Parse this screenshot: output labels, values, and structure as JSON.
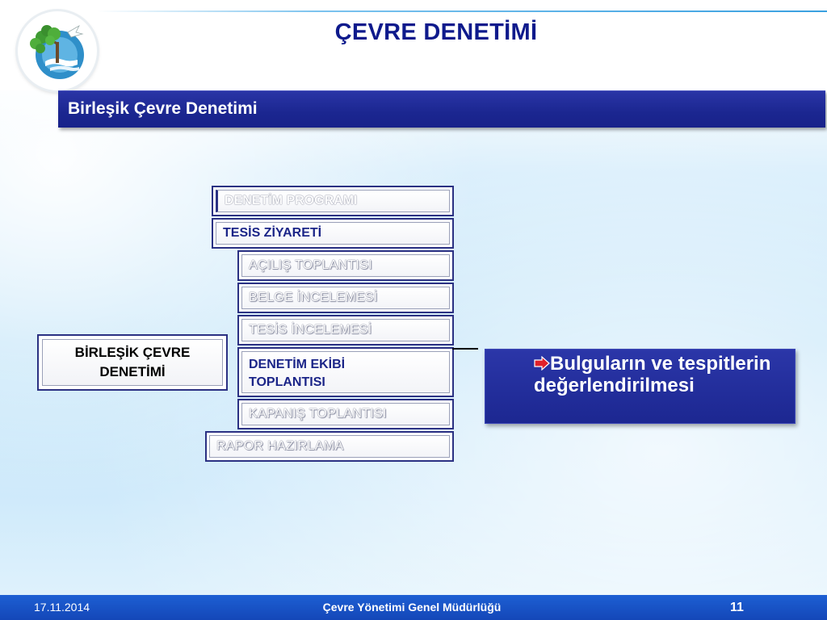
{
  "header": {
    "title": "ÇEVRE DENETİMİ",
    "logo": "ministry-tree-logo"
  },
  "section": {
    "title": "Birleşik Çevre Denetimi"
  },
  "birlesik_box": {
    "label": "BİRLEŞİK ÇEVRE\nDENETİMİ"
  },
  "steps": [
    {
      "label": "DENETİM PROGRAMI"
    },
    {
      "label": "TESİS ZİYARETİ"
    },
    {
      "label": "AÇILIŞ TOPLANTISI"
    },
    {
      "label": "BELGE İNCELEMESİ"
    },
    {
      "label": "TESİS İNCELEMESİ"
    },
    {
      "label": "DENETİM EKİBİ TOPLANTISI"
    },
    {
      "label": "KAPANIŞ TOPLANTISI"
    },
    {
      "label": "RAPOR HAZIRLAMA"
    }
  ],
  "findings": {
    "text": "Bulguların ve tespitlerin değerlendirilmesi",
    "bullet_icon": "red-arrow-icon"
  },
  "footer": {
    "date": "17.11.2014",
    "organization": "Çevre Yönetimi Genel Müdürlüğü",
    "page_number": "11"
  },
  "colors": {
    "title": "#0e1a8c",
    "bar": "#1b2690",
    "footer": "#1a55c8",
    "active_step_text": "#1b2588",
    "bullet": "#e0202a"
  }
}
